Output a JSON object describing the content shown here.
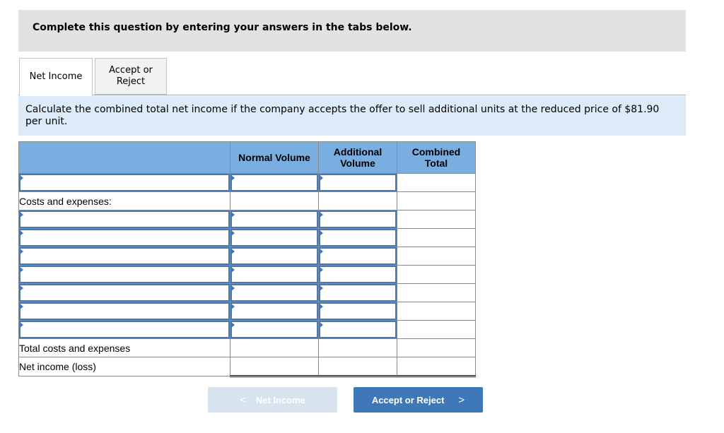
{
  "header": {
    "title": "Complete this question by entering your answers in the tabs below."
  },
  "tabs": [
    {
      "label_line1": "Net Income",
      "label_line2": "",
      "active": true
    },
    {
      "label_line1": "Accept or",
      "label_line2": "Reject",
      "active": false
    }
  ],
  "instruction": "Calculate the combined total net income if the company accepts the offer to sell additional units at the reduced price of $81.90 per unit.",
  "table": {
    "columns": [
      {
        "line1": "",
        "line2": ""
      },
      {
        "line1": "Normal Volume",
        "line2": ""
      },
      {
        "line1": "Additional",
        "line2": "Volume"
      },
      {
        "line1": "Combined",
        "line2": "Total"
      }
    ],
    "rows": [
      {
        "label": "",
        "type": "input",
        "values": [
          "",
          "",
          ""
        ]
      },
      {
        "label": "Costs and expenses:",
        "type": "static",
        "values": [
          "",
          "",
          ""
        ]
      },
      {
        "label": "",
        "type": "input",
        "values": [
          "",
          "",
          ""
        ]
      },
      {
        "label": "",
        "type": "input",
        "values": [
          "",
          "",
          ""
        ]
      },
      {
        "label": "",
        "type": "input",
        "values": [
          "",
          "",
          ""
        ]
      },
      {
        "label": "",
        "type": "input",
        "values": [
          "",
          "",
          ""
        ]
      },
      {
        "label": "",
        "type": "input",
        "values": [
          "",
          "",
          ""
        ]
      },
      {
        "label": "",
        "type": "input",
        "values": [
          "",
          "",
          ""
        ]
      },
      {
        "label": "",
        "type": "input",
        "values": [
          "",
          "",
          ""
        ]
      },
      {
        "label": "Total costs and expenses",
        "type": "total",
        "values": [
          "",
          "",
          ""
        ]
      },
      {
        "label": "Net income (loss)",
        "type": "net",
        "values": [
          "",
          "",
          ""
        ]
      }
    ]
  },
  "nav": {
    "prev_label": "Net Income",
    "prev_icon": "chevron-left-icon",
    "next_label": "Accept or Reject",
    "next_icon": "chevron-right-icon",
    "prev_enabled": false
  },
  "colors": {
    "header_band": "#e2e2e2",
    "instruction_bg": "#dcebf7",
    "table_header": "#7aaee0",
    "input_border": "#4a78b0",
    "next_button": "#3f78b8",
    "prev_button_disabled": "#d8e3f0"
  }
}
